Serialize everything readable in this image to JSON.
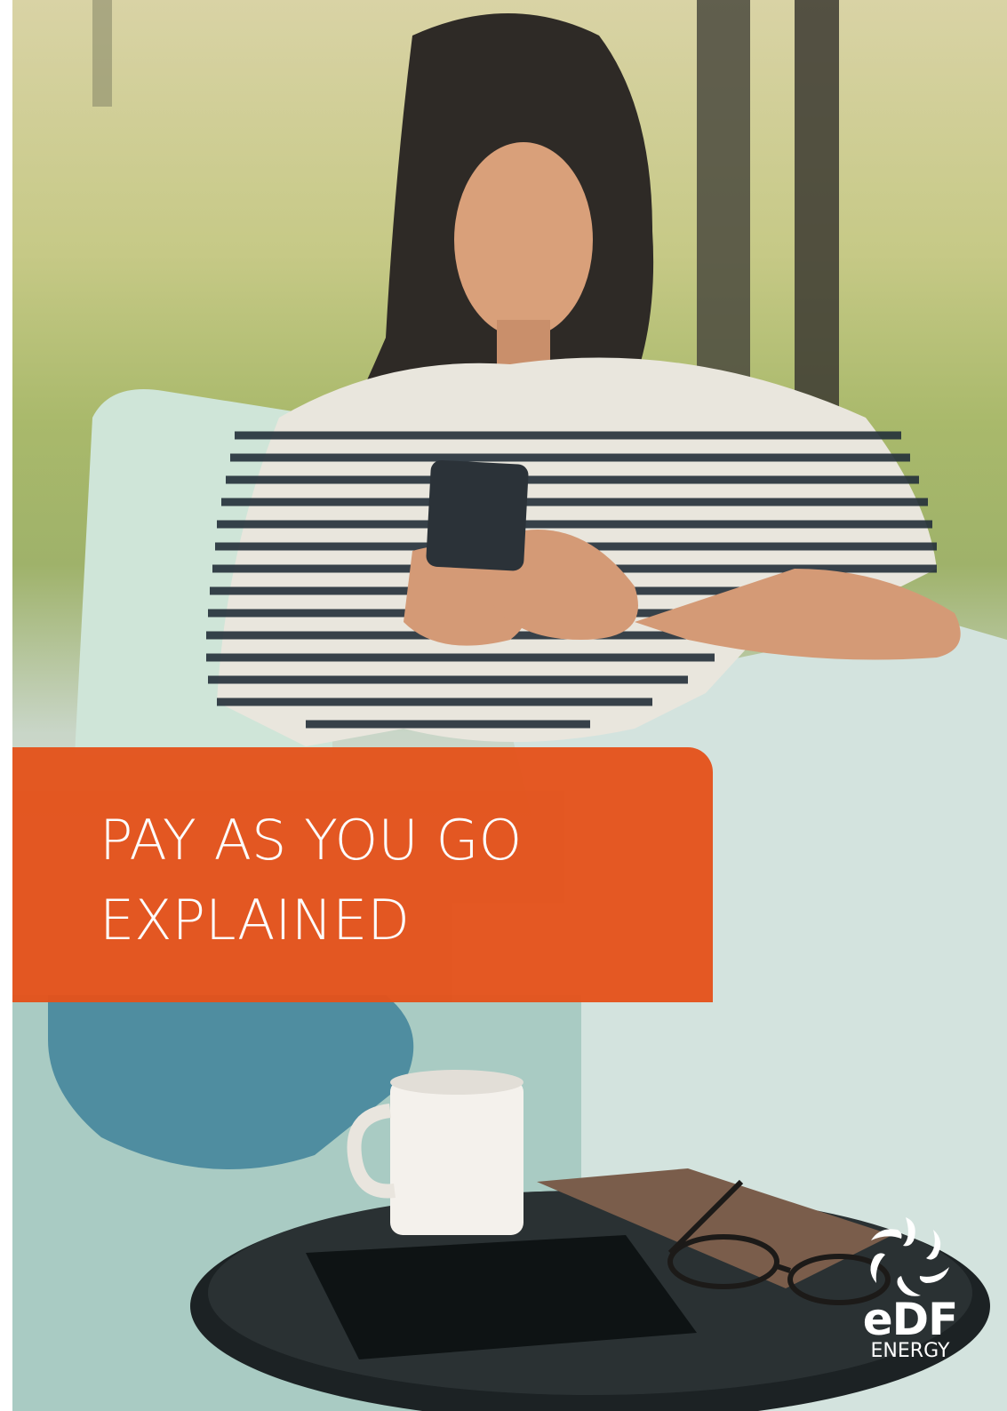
{
  "cover": {
    "title_lines": [
      "PAY AS YOU GO",
      "EXPLAINED"
    ],
    "banner_color": "#e4521b",
    "photo_description": "cover-photo"
  },
  "logo": {
    "brand": "eDF",
    "sub": "ENERGY",
    "color": "#ffffff"
  }
}
